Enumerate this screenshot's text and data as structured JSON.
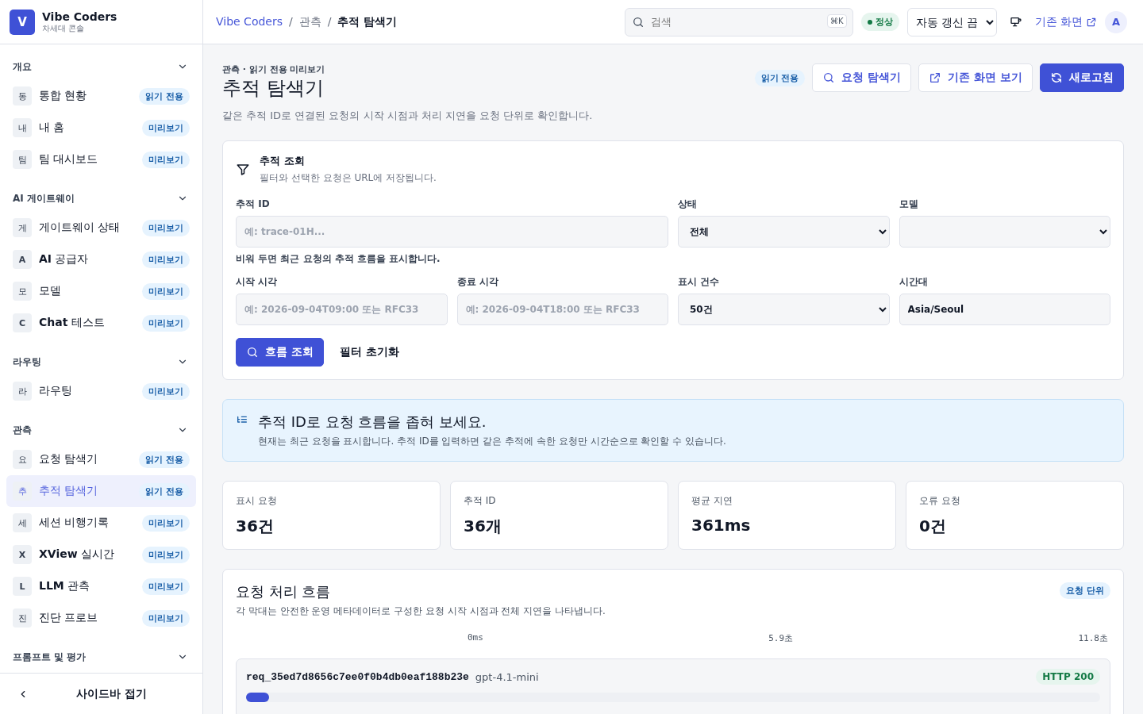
{
  "brand": {
    "logo": "V",
    "name": "Vibe Coders",
    "subtitle": "차세대 콘솔"
  },
  "sidebar": {
    "groups": [
      {
        "title": "개요",
        "items": [
          {
            "glyph": "동",
            "label": "통합 현황",
            "badge": "읽기 전용",
            "selected": false
          },
          {
            "glyph": "내",
            "label": "내 홈",
            "badge": "미리보기",
            "selected": false
          },
          {
            "glyph": "팀",
            "label": "팀 대시보드",
            "badge": "미리보기",
            "selected": false
          }
        ]
      },
      {
        "title": "AI 게이트웨이",
        "items": [
          {
            "glyph": "게",
            "label": "게이트웨이 상태",
            "badge": "미리보기",
            "selected": false
          },
          {
            "glyph": "**A**",
            "label": "**AI** 공급자",
            "badge": "미리보기",
            "selected": false
          },
          {
            "glyph": "모",
            "label": "모델",
            "badge": "미리보기",
            "selected": false
          },
          {
            "glyph": "**C**",
            "label": "**Chat** 테스트",
            "badge": "미리보기",
            "selected": false
          }
        ]
      },
      {
        "title": "라우팅",
        "items": [
          {
            "glyph": "라",
            "label": "라우팅",
            "badge": "미리보기",
            "selected": false
          }
        ]
      },
      {
        "title": "관측",
        "items": [
          {
            "glyph": "요",
            "label": "요청 탐색기",
            "badge": "읽기 전용",
            "selected": false
          },
          {
            "glyph": "추",
            "label": "추적 탐색기",
            "badge": "읽기 전용",
            "selected": true
          },
          {
            "glyph": "세",
            "label": "세션 비행기록",
            "badge": "미리보기",
            "selected": false
          },
          {
            "glyph": "**X**",
            "label": "**XView** 실시간",
            "badge": "미리보기",
            "selected": false
          },
          {
            "glyph": "**L**",
            "label": "**LLM** 관측",
            "badge": "미리보기",
            "selected": false
          },
          {
            "glyph": "진",
            "label": "진단 프로브",
            "badge": "미리보기",
            "selected": false
          }
        ]
      },
      {
        "title": "프롬프트 및 평가"
      }
    ],
    "collapse": "사이드바 접기"
  },
  "topbar": {
    "breadcrumbs": [
      "Vibe Coders",
      "관측",
      "추적 탐색기"
    ],
    "separators": [
      "/",
      "/"
    ],
    "search": {
      "placeholder": "검색",
      "shortcut": "⌘K"
    },
    "status": "정상",
    "refresh_select": "자동 갱신 끔",
    "legacy_link": "기존 화면",
    "avatar": "A"
  },
  "header": {
    "eyebrow": "관측 · 읽기 전용 미리보기",
    "title": "추적 탐색기",
    "description": "같은 추적 ID로 연결된 요청의 시작 시점과 처리 지연을 요청 단위로 확인합니다.",
    "badge": "읽기 전용",
    "buttons": [
      {
        "kind": "search",
        "label": "요청 탐색기"
      },
      {
        "kind": "external",
        "label": "기존 화면 보기"
      },
      {
        "kind": "refresh",
        "label": "새로고침"
      }
    ]
  },
  "filter": {
    "title": "추적 조회",
    "subtitle": "필터와 선택한 요청은 URL에 저장됩니다.",
    "trace_id": {
      "label": "추적 ID",
      "placeholder": "예: trace-01H...",
      "hint": "비워 두면 최근 요청의 추적 흐름을 표시합니다."
    },
    "status": {
      "label": "상태",
      "value": "전체"
    },
    "model": {
      "label": "모델"
    },
    "start": {
      "label": "시작 시각",
      "placeholder": "예: 2026-09-04T09:00 또는 RFC33"
    },
    "end": {
      "label": "종료 시각",
      "placeholder": "예: 2026-09-04T18:00 또는 RFC33"
    },
    "count": {
      "label": "표시 건수",
      "value": "50건"
    },
    "timezone": {
      "label": "시간대",
      "value": "Asia/Seoul"
    },
    "submit": "흐름 조회",
    "reset": "필터 초기화"
  },
  "notice": {
    "title": "추적 ID로 요청 흐름을 좁혀 보세요.",
    "text": "현재는 최근 요청을 표시합니다. 추적 ID를 입력하면 같은 추적에 속한 요청만 시간순으로 확인할 수 있습니다."
  },
  "stats": [
    {
      "label": "표시 요청",
      "value": "36건"
    },
    {
      "label": "추적 ID",
      "value": "36개"
    },
    {
      "label": "평균 지연",
      "value": "361ms"
    },
    {
      "label": "오류 요청",
      "value": "0건"
    }
  ],
  "flow": {
    "title": "요청 처리 흐름",
    "subtitle": "각 막대는 안전한 운영 메타데이터로 구성한 요청 시작 시점과 전체 지연을 나타냅니다.",
    "badge": "요청 단위",
    "ticks": [
      "0ms",
      "5.9초",
      "11.8초"
    ],
    "rows": [
      {
        "id": "req_35ed7d8656c7ee0f0b4db0eaf188b23e",
        "model": "gpt-4.1-mini",
        "status": "HTTP 200",
        "level": 0.027
      }
    ]
  }
}
